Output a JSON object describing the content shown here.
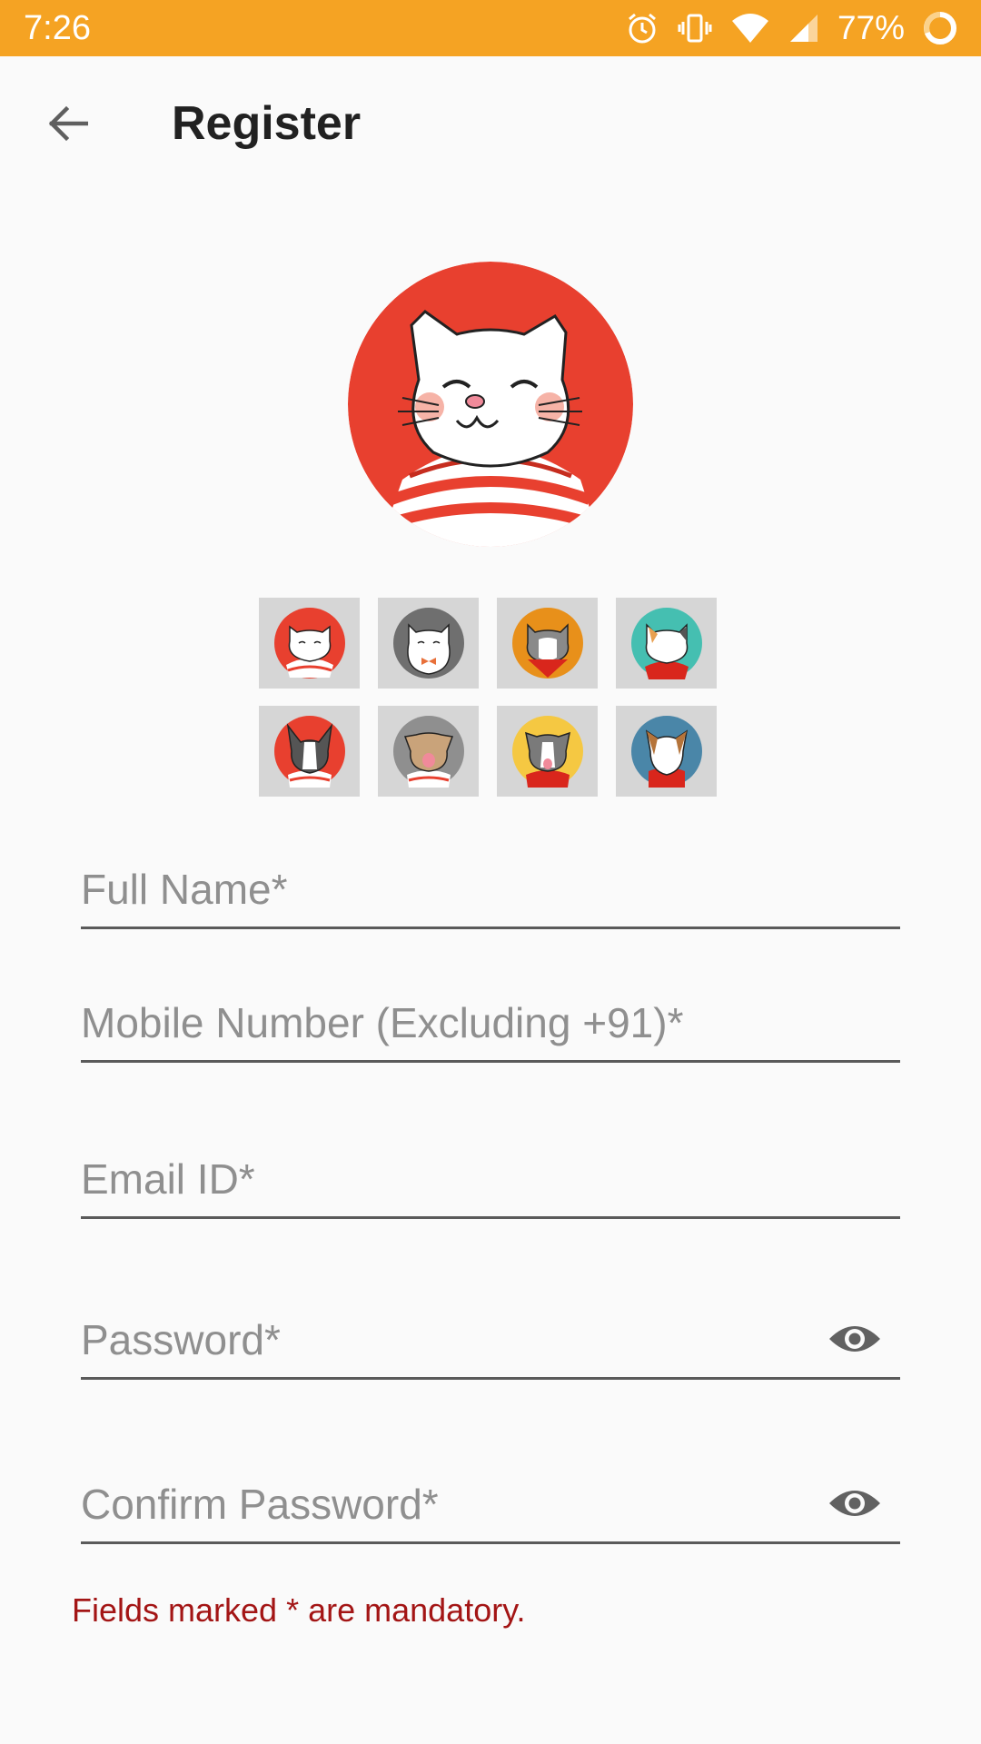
{
  "status_bar": {
    "time": "7:26",
    "battery": "77%",
    "icons": [
      "alarm-icon",
      "vibrate-icon",
      "wifi-icon",
      "signal-icon",
      "battery-ring-icon"
    ],
    "color": "#f5a323"
  },
  "app_bar": {
    "title": "Register",
    "back_icon": "arrow-left-icon"
  },
  "avatars": {
    "selected": "cat-red-striped",
    "options": [
      {
        "name": "cat-red-striped",
        "bg": "#e8402f"
      },
      {
        "name": "cat-grey-bowtie",
        "bg": "#6f6f6f"
      },
      {
        "name": "cat-orange-bandana",
        "bg": "#e8901a"
      },
      {
        "name": "cat-teal-calico",
        "bg": "#45bfb1"
      },
      {
        "name": "dog-red-bulldog",
        "bg": "#e8402f"
      },
      {
        "name": "dog-grey-pug",
        "bg": "#8f8f8f"
      },
      {
        "name": "dog-yellow-pitbull",
        "bg": "#f5c842"
      },
      {
        "name": "dog-blue-terrier",
        "bg": "#4a86a8"
      }
    ]
  },
  "form": {
    "full_name": {
      "placeholder": "Full Name*",
      "value": ""
    },
    "mobile": {
      "placeholder": "Mobile Number (Excluding +91)*",
      "value": ""
    },
    "email": {
      "placeholder": "Email ID*",
      "value": ""
    },
    "password": {
      "placeholder": "Password*",
      "value": "",
      "icon": "eye-icon"
    },
    "confirm_password": {
      "placeholder": "Confirm Password*",
      "value": "",
      "icon": "eye-icon"
    }
  },
  "mandatory_note": "Fields marked * are mandatory.",
  "colors": {
    "accent": "#f5a323",
    "error_text": "#a31515",
    "title_text": "#212121",
    "placeholder_text": "#8f8f8f"
  }
}
